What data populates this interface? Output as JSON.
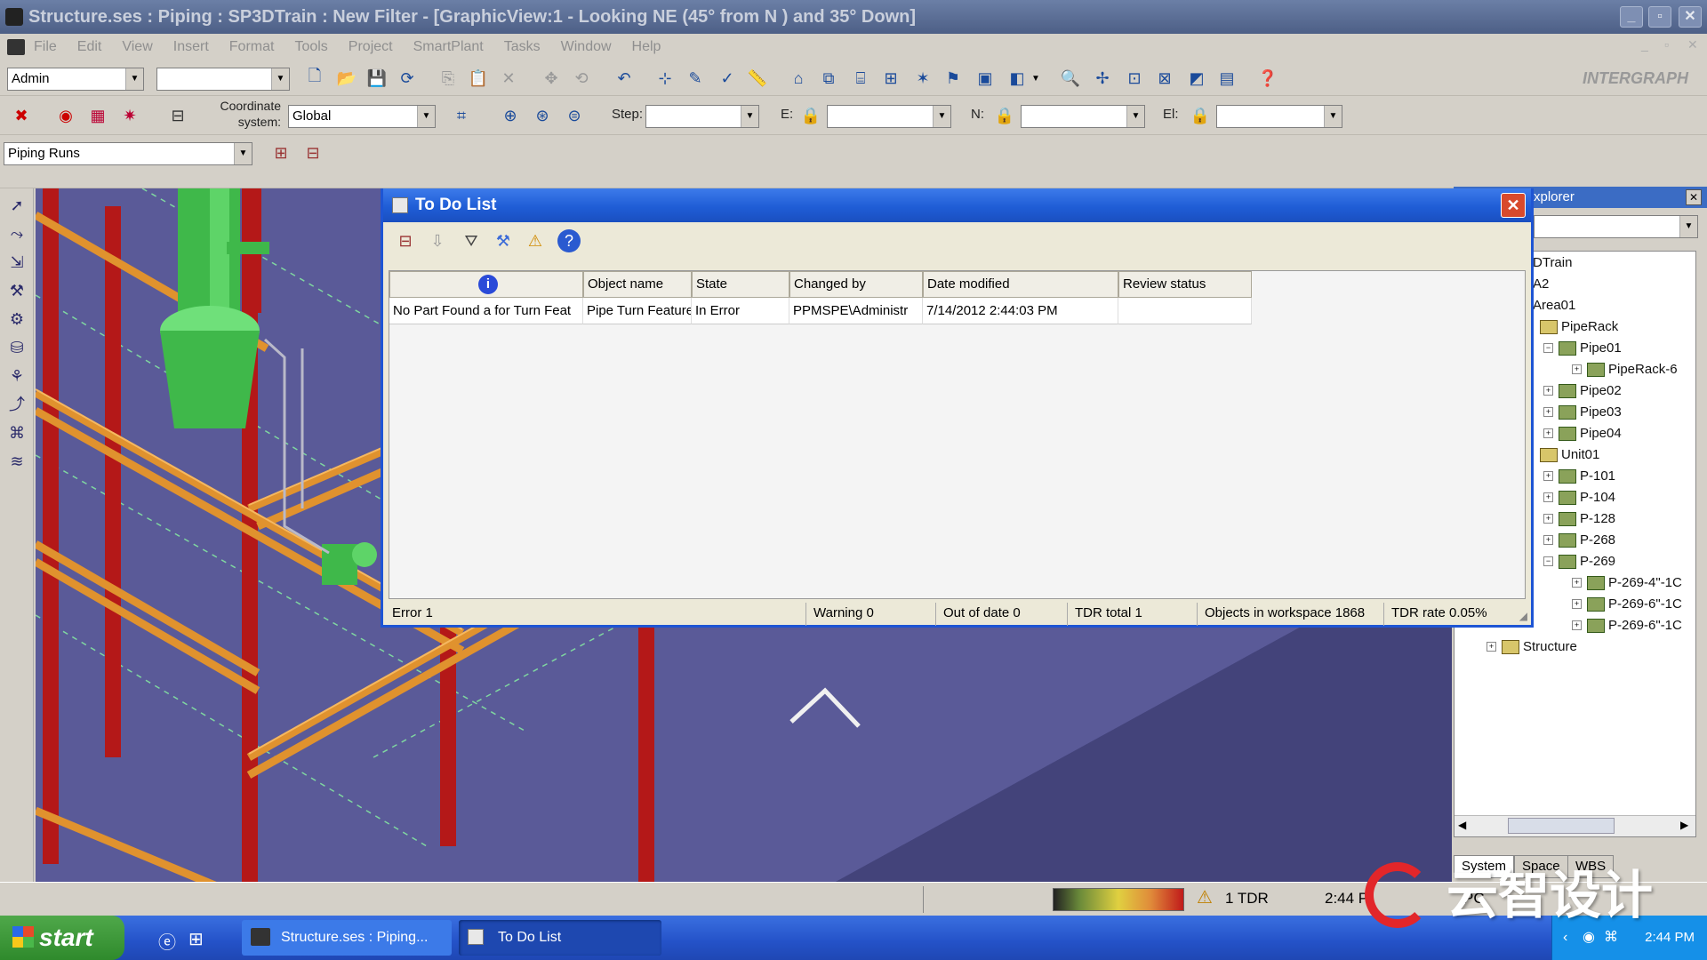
{
  "window": {
    "title": "Structure.ses : Piping : SP3DTrain : New Filter - [GraphicView:1 - Looking NE (45° from N ) and 35° Down]"
  },
  "menu": [
    "File",
    "Edit",
    "View",
    "Insert",
    "Format",
    "Tools",
    "Project",
    "SmartPlant",
    "Tasks",
    "Window",
    "Help"
  ],
  "toolbar": {
    "permission_group": "Admin",
    "coordinate_label": "Coordinate system:",
    "coordinate_value": "Global",
    "step_label": "Step:",
    "e_label": "E:",
    "n_label": "N:",
    "el_label": "El:",
    "brand": "INTERGRAPH",
    "locate_filter": "Piping Runs"
  },
  "dialog": {
    "title": "To Do List",
    "columns": [
      "",
      "Object name",
      "State",
      "Changed by",
      "Date modified",
      "Review status"
    ],
    "rows": [
      {
        "description": "No Part Found a for Turn Feat",
        "object_name": "Pipe Turn Feature",
        "state": "In Error",
        "changed_by": "PPMSPE\\Administr",
        "date_modified": "7/14/2012 2:44:03 PM",
        "review_status": ""
      }
    ],
    "status": {
      "error": "Error 1",
      "warning": "Warning 0",
      "out_of_date": "Out of date 0",
      "tdr_total": "TDR total 1",
      "objects": "Objects in workspace 1868",
      "tdr_rate": "TDR rate 0.05%"
    }
  },
  "explorer": {
    "title": "xplorer",
    "tree": [
      {
        "label": "DTrain"
      },
      {
        "label": "A2"
      },
      {
        "label": "Area01"
      },
      {
        "label": "PipeRack"
      },
      {
        "label": "Pipe01"
      },
      {
        "label": "PipeRack-6"
      },
      {
        "label": "Pipe02"
      },
      {
        "label": "Pipe03"
      },
      {
        "label": "Pipe04"
      },
      {
        "label": "Unit01"
      },
      {
        "label": "P-101"
      },
      {
        "label": "P-104"
      },
      {
        "label": "P-128"
      },
      {
        "label": "P-268"
      },
      {
        "label": "P-269"
      },
      {
        "label": "P-269-4\"-1C"
      },
      {
        "label": "P-269-6\"-1C"
      },
      {
        "label": "P-269-6\"-1C"
      },
      {
        "label": "Structure"
      }
    ],
    "tabs": [
      "System",
      "Space",
      "WBS"
    ]
  },
  "statusbar": {
    "tdr": "1 TDR",
    "time_fragment": "2:44 P",
    "fragment2": "PC"
  },
  "taskbar": {
    "start": "start",
    "items": [
      "Structure.ses : Piping...",
      "To Do List"
    ],
    "clock": "2:44 PM"
  },
  "watermark": "云智设计",
  "colors": {
    "dialog_title": "#1f5dd6",
    "viewport": "#4a4a86",
    "steel_red": "#b01818",
    "pipe_orange": "#e08a2a",
    "equipment_green": "#4fc84f"
  }
}
